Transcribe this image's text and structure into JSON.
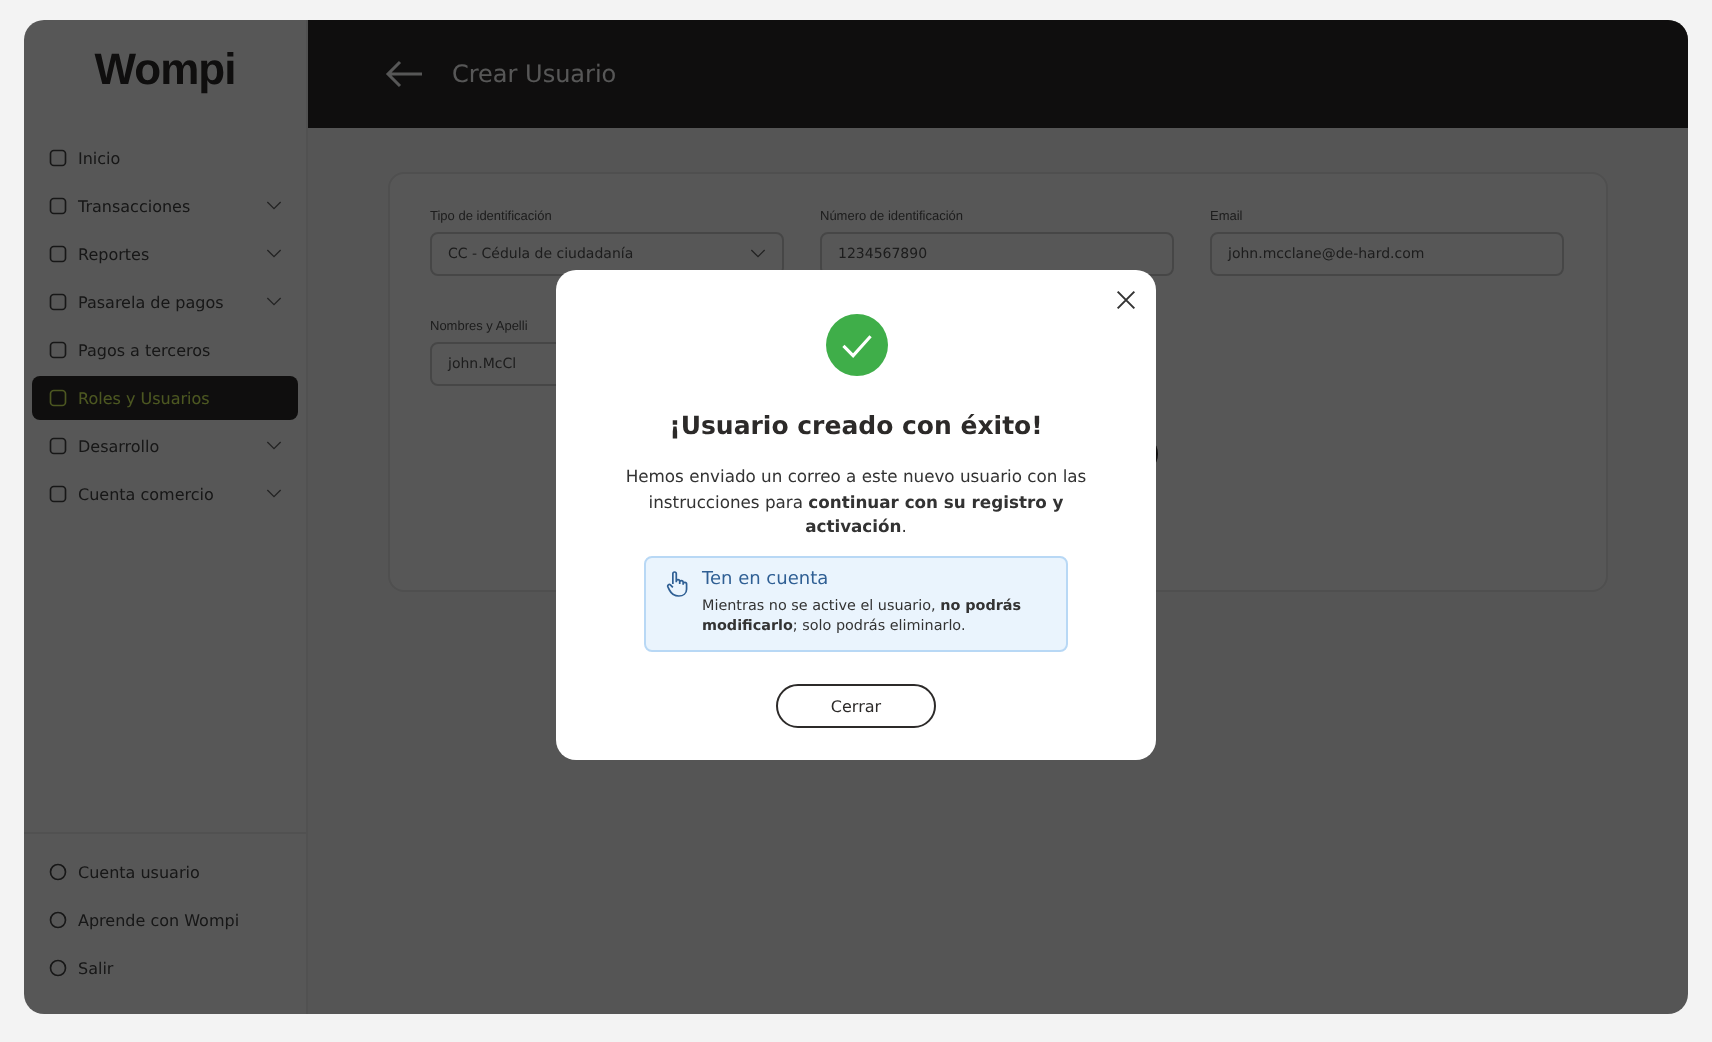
{
  "brand": {
    "logo": "Wompi"
  },
  "sidebar": {
    "items": [
      {
        "label": "Inicio",
        "expandable": false,
        "selected": false
      },
      {
        "label": "Transacciones",
        "expandable": true,
        "selected": false
      },
      {
        "label": "Reportes",
        "expandable": true,
        "selected": false
      },
      {
        "label": "Pasarela de pagos",
        "expandable": true,
        "selected": false
      },
      {
        "label": "Pagos a terceros",
        "expandable": false,
        "selected": false
      },
      {
        "label": "Roles y Usuarios",
        "expandable": false,
        "selected": true
      },
      {
        "label": "Desarrollo",
        "expandable": true,
        "selected": false
      },
      {
        "label": "Cuenta comercio",
        "expandable": true,
        "selected": false
      }
    ],
    "footer_items": [
      {
        "label": "Cuenta usuario"
      },
      {
        "label": "Aprende con Wompi"
      },
      {
        "label": "Salir"
      }
    ]
  },
  "header": {
    "title": "Crear Usuario"
  },
  "form": {
    "fields": [
      {
        "label": "Tipo de identificación",
        "value": "CC - Cédula de ciudadanía",
        "kind": "select"
      },
      {
        "label": "Número de identificación",
        "value": "1234567890",
        "kind": "text"
      },
      {
        "label": "Email",
        "value": "john.mcclane@de-hard.com",
        "kind": "text"
      },
      {
        "label": "Nombres y Apelli",
        "value": "john.McCl",
        "kind": "text"
      }
    ]
  },
  "modal": {
    "title": "¡Usuario creado con éxito!",
    "message": "Hemos enviado un correo a este nuevo usuario con las instrucciones para **continuar con su registro y activación**.",
    "notice": {
      "title": "Ten en cuenta",
      "text": "Mientras no se active el usuario, **no podrás modificarlo**; solo podrás eliminarlo."
    },
    "close_button": "Cerrar"
  }
}
